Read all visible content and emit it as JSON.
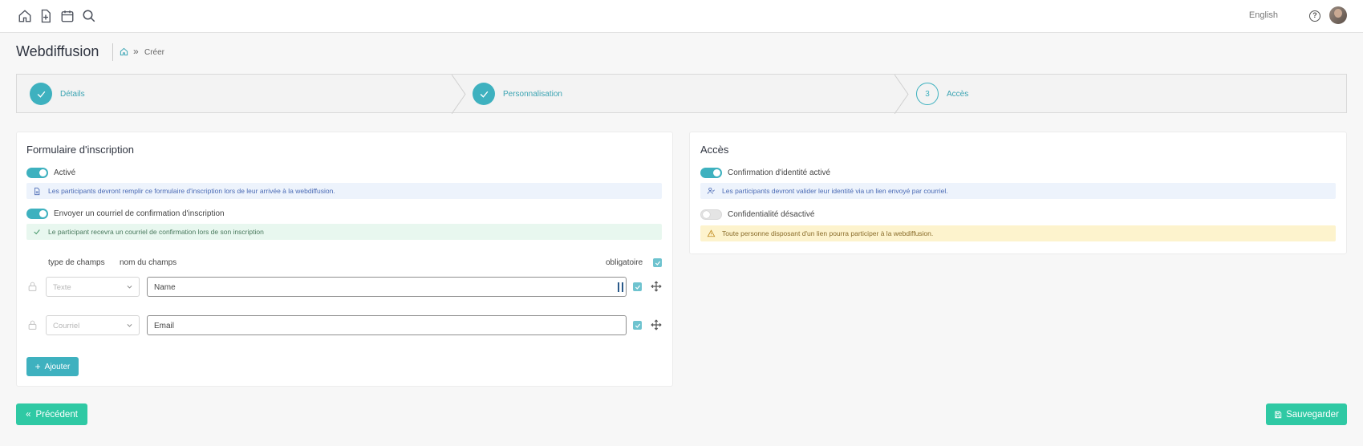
{
  "topbar": {
    "icons": [
      "home-icon",
      "new-file-icon",
      "calendar-icon",
      "search-icon"
    ],
    "language": "English",
    "help_icon": "question-circle-icon"
  },
  "header": {
    "title": "Webdiffusion",
    "breadcrumb_home_icon": "home-icon",
    "breadcrumb_separator": "»",
    "breadcrumb_current": "Créer"
  },
  "stepper": {
    "steps": [
      {
        "number": "1",
        "label": "Détails",
        "state": "done"
      },
      {
        "number": "2",
        "label": "Personnalisation",
        "state": "done"
      },
      {
        "number": "3",
        "label": "Accès",
        "state": "current"
      }
    ]
  },
  "registration": {
    "title": "Formulaire d'inscription",
    "toggle_active": {
      "label": "Activé",
      "on": true
    },
    "info_active": "Les participants devront remplir ce formulaire d'inscription lors de leur arrivée à la webdiffusion.",
    "toggle_email": {
      "label": "Envoyer un courriel de confirmation d'inscription",
      "on": true
    },
    "info_email": "Le participant recevra un courriel de confirmation lors de son inscription",
    "columns": {
      "type": "type de champs",
      "name": "nom du champs",
      "required": "obligatoire"
    },
    "fields": [
      {
        "type": "Texte",
        "name": "Name",
        "required": true
      },
      {
        "type": "Courriel",
        "name": "Email",
        "required": true
      }
    ],
    "add_button": "Ajouter"
  },
  "access": {
    "title": "Accès",
    "toggle_identity": {
      "label": "Confirmation d'identité activé",
      "on": true
    },
    "info_identity": "Les participants devront valider leur identité via un lien envoyé par courriel.",
    "toggle_privacy": {
      "label": "Confidentialité désactivé",
      "on": false
    },
    "warn_privacy": "Toute personne disposant d'un lien pourra participer à la webdiffusion."
  },
  "footer": {
    "prev_button": "Précédent",
    "save_button": "Sauvegarder"
  },
  "colors": {
    "accent": "#3eb1bf",
    "success_button": "#2fc9a4",
    "info_bg": "#edf3fc",
    "success_bg": "#e8f7ef",
    "warning_bg": "#fdf3cd"
  }
}
